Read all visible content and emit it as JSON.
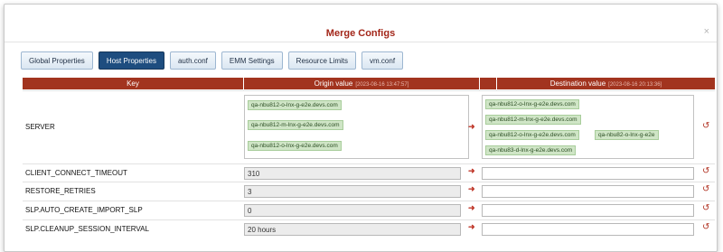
{
  "dialog": {
    "title": "Merge Configs",
    "close_label": "×"
  },
  "tabs": [
    "Global Properties",
    "Host Properties",
    "auth.conf",
    "EMM Settings",
    "Resource Limits",
    "vm.conf"
  ],
  "active_tab": "Host Properties",
  "columns": {
    "key": "Key",
    "origin": "Origin value",
    "origin_ts": "[2023-08-16 13:47:57]",
    "destination": "Destination value",
    "destination_ts": "[2023-08-16 20:13:36]"
  },
  "icons": {
    "copy_arrow": "right-arrow-icon",
    "undo": "undo-icon"
  },
  "server": {
    "key": "SERVER",
    "origin": [
      "qa-nbu812-o-lnx-g-e2e.devs.com",
      "qa-nbu812-m-lnx-g-e2e.devs.com",
      "qa-nbu812-o-lnx-g-e2e.devs.com"
    ],
    "destination": [
      "qa-nbu812-o-lnx-g-e2e.devs.com",
      "qa-nbu812-m-lnx-g-e2e.devs.com",
      "qa-nbu812-o-lnx-g-e2e.devs.com",
      "qa-nbu82-o-lnx-g-e2e",
      "qa-nbu83-d-lnx-g-e2e.devs.com"
    ]
  },
  "rows": [
    {
      "key": "CLIENT_CONNECT_TIMEOUT",
      "origin": "310",
      "destination": ""
    },
    {
      "key": "RESTORE_RETRIES",
      "origin": "3",
      "destination": ""
    },
    {
      "key": "SLP.AUTO_CREATE_IMPORT_SLP",
      "origin": "0",
      "destination": ""
    },
    {
      "key": "SLP.CLEANUP_SESSION_INTERVAL",
      "origin": "20 hours",
      "destination": ""
    }
  ],
  "colors": {
    "accent": "#a2341f",
    "active_tab": "#1e4d7f",
    "chip": "#cfe5c6"
  }
}
